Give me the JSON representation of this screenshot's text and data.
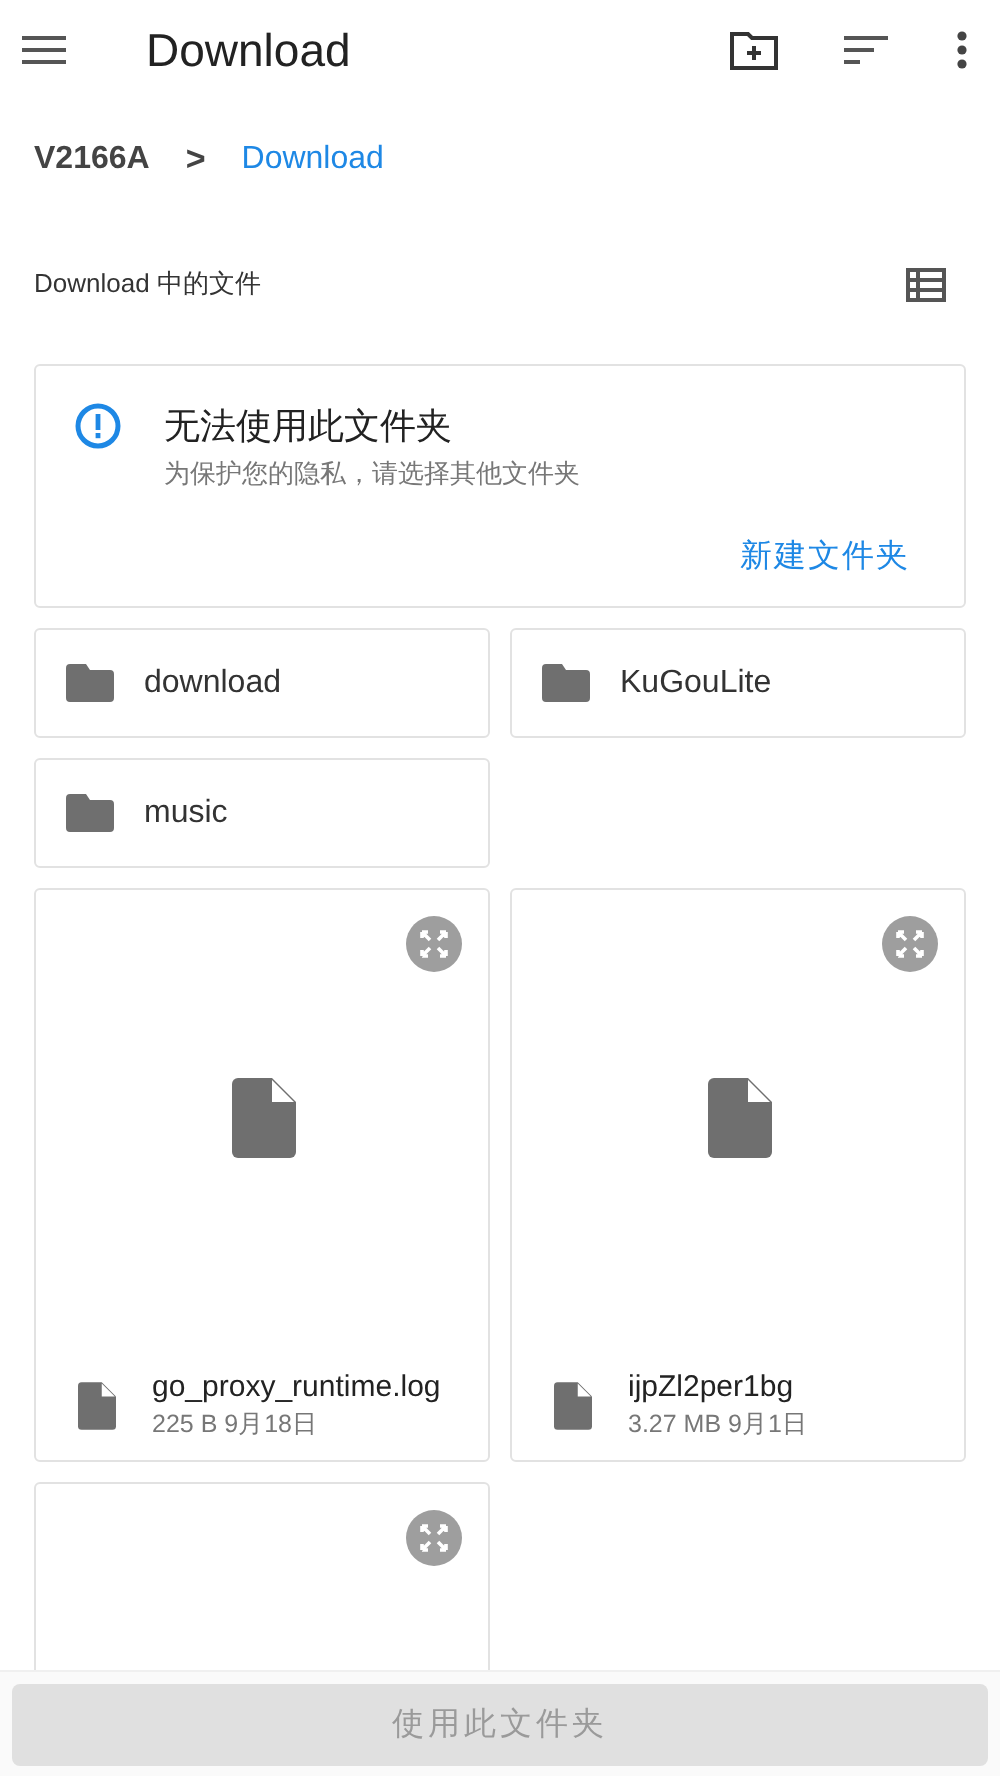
{
  "app_bar": {
    "title": "Download"
  },
  "breadcrumb": [
    {
      "label": "V2166A",
      "selected": false
    },
    {
      "label": "Download",
      "selected": true
    }
  ],
  "breadcrumb_separator": ">",
  "section_label": "Download 中的文件",
  "notice": {
    "title": "无法使用此文件夹",
    "message": "为保护您的隐私，请选择其他文件夹",
    "action": "新建文件夹"
  },
  "folders": [
    {
      "name": "download"
    },
    {
      "name": "KuGouLite"
    },
    {
      "name": "music"
    }
  ],
  "files": [
    {
      "kind": "file",
      "name": "go_proxy_runtime.log",
      "meta": "225 B 9月18日"
    },
    {
      "kind": "file",
      "name": "ijpZl2per1bg",
      "meta": "3.27 MB 9月1日"
    },
    {
      "kind": "file"
    }
  ],
  "bottom_button": {
    "label": "使用此文件夹",
    "disabled": true
  }
}
